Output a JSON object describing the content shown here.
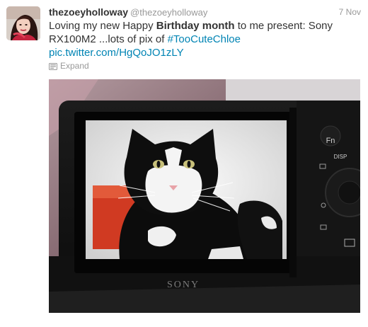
{
  "tweet": {
    "fullname": "thezoeyholloway",
    "username": "@thezoeyholloway",
    "time": "7 Nov",
    "text_part1": "Loving my new Happy ",
    "text_bold": "Birthday month",
    "text_part2": " to me present: Sony RX100M2 ...lots of pix of ",
    "hashtag": "#TooCuteChloe",
    "pic_link": "pic.twitter.com/HgQoJO1zLY",
    "expand_label": "Expand",
    "expand_icon": "media-icon"
  },
  "photo": {
    "camera_brand": "SONY",
    "fn_label": "Fn",
    "disp_label": "DISP"
  },
  "colors": {
    "link": "#0084b4",
    "meta": "#999999",
    "text": "#333333"
  }
}
